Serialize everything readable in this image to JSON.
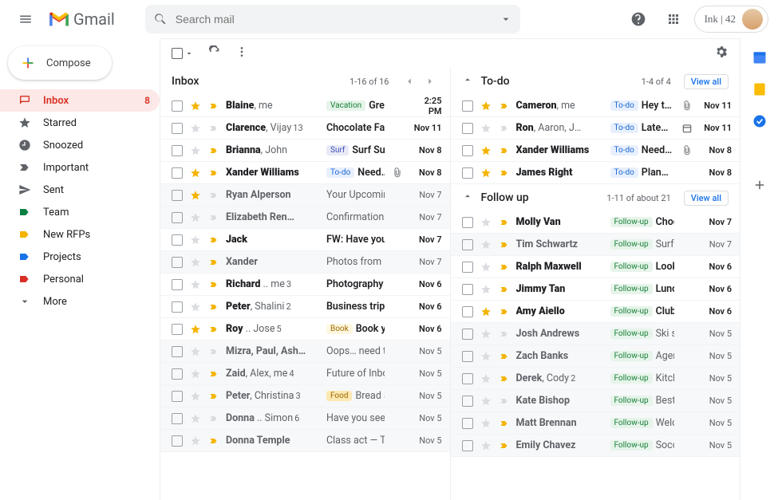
{
  "header": {
    "app_name": "Gmail",
    "search_placeholder": "Search mail",
    "profile_label": "Ink | 42"
  },
  "compose_label": "Compose",
  "nav": [
    {
      "icon": "inbox",
      "label": "Inbox",
      "count": "8",
      "active": true
    },
    {
      "icon": "star",
      "label": "Starred"
    },
    {
      "icon": "clock",
      "label": "Snoozed"
    },
    {
      "icon": "important",
      "label": "Important"
    },
    {
      "icon": "send",
      "label": "Sent"
    },
    {
      "icon": "tag-green",
      "label": "Team"
    },
    {
      "icon": "tag-yellow",
      "label": "New RFPs"
    },
    {
      "icon": "tag-blue",
      "label": "Projects"
    },
    {
      "icon": "tag-red",
      "label": "Personal"
    },
    {
      "icon": "more",
      "label": "More"
    }
  ],
  "inbox": {
    "title": "Inbox",
    "range": "1-16 of 16",
    "rows": [
      {
        "unread": true,
        "star": true,
        "marker": true,
        "from": "Blaine",
        "from2": ", me",
        "tag": "Vacation",
        "tag_cls": "vacation",
        "subject": "Greece…",
        "date": "2:25 PM"
      },
      {
        "unread": true,
        "star": false,
        "marker": false,
        "from": "Clarence",
        "from2": ", Vijay",
        "tnum": "13",
        "subject": "Chocolate Factor…",
        "date": "Nov 11"
      },
      {
        "unread": true,
        "star": false,
        "marker": true,
        "from": "Brianna",
        "from2": ", John",
        "tag": "Surf",
        "tag_cls": "surf",
        "subject": "Surf Sunda…",
        "date": "Nov 8"
      },
      {
        "unread": true,
        "star": true,
        "marker": true,
        "from": "Xander Williams",
        "tag": "To-do",
        "tag_cls": "todo",
        "subject": "Need…",
        "attach": true,
        "date": "Nov 8"
      },
      {
        "unread": false,
        "star": true,
        "marker": false,
        "from": "Ryan Alperson",
        "subject": "Your Upcoming R…",
        "date": "Nov 7"
      },
      {
        "unread": false,
        "star": false,
        "marker": false,
        "from": "Elizabeth Ren…",
        "subject": "Confirmation for…",
        "date": "Nov 7"
      },
      {
        "unread": true,
        "star": false,
        "marker": true,
        "from": "Jack",
        "subject": "FW: Have you ev…",
        "date": "Nov 7"
      },
      {
        "unread": false,
        "star": false,
        "marker": true,
        "from": "Xander",
        "subject": "Photos from my r…",
        "date": "Nov 7"
      },
      {
        "unread": true,
        "star": false,
        "marker": true,
        "from": "Richard",
        "from2": " .. me",
        "tnum": "3",
        "subject": "Photography clas…",
        "date": "Nov 6"
      },
      {
        "unread": true,
        "star": false,
        "marker": true,
        "from": "Peter",
        "from2": ", Shalini",
        "tnum": "2",
        "subject": "Business trip — H…",
        "date": "Nov 6"
      },
      {
        "unread": true,
        "star": true,
        "marker": true,
        "from": "Roy",
        "from2": " .. Jose",
        "tnum": "5",
        "tag": "Book",
        "tag_cls": "book",
        "subject": "Book you r…",
        "date": "Nov 6"
      },
      {
        "unread": false,
        "star": false,
        "marker": false,
        "from": "Mizra, Paul, Ash…",
        "subject": "Oops… need to re…",
        "date": "Nov 5"
      },
      {
        "unread": false,
        "star": false,
        "marker": true,
        "from": "Zaid",
        "from2": ", Alex, me",
        "tnum": "4",
        "subject": "Future of Inbox —…",
        "date": "Nov 5"
      },
      {
        "unread": false,
        "star": false,
        "marker": true,
        "from": "Peter",
        "from2": ", Christina",
        "tnum": "3",
        "tag": "Food",
        "tag_cls": "food",
        "subject": "Bread and…",
        "date": "Nov 5"
      },
      {
        "unread": false,
        "star": false,
        "marker": false,
        "from": "Donna",
        "from2": " .. Simon",
        "tnum": "6",
        "subject": "Have you seen th…",
        "date": "Nov 5"
      },
      {
        "unread": false,
        "star": false,
        "marker": true,
        "from": "Donna Temple",
        "subject": "Class act — Tom…",
        "date": "Nov 5"
      }
    ]
  },
  "sections": [
    {
      "title": "To-do",
      "range": "1-4 of 4",
      "viewall": "View all",
      "rows": [
        {
          "unread": true,
          "star": true,
          "marker": true,
          "from": "Cameron",
          "from2": ", me",
          "tag": "To-do",
          "tag_cls": "todo",
          "subject": "Hey t…",
          "attach": true,
          "date": "Nov 11"
        },
        {
          "unread": true,
          "star": false,
          "marker": false,
          "from": "Ron",
          "from2": ", Aaron, J…",
          "tag": "To-do",
          "tag_cls": "todo",
          "subject": "Late…",
          "cal": true,
          "date": "Nov 11"
        },
        {
          "unread": true,
          "star": true,
          "marker": true,
          "from": "Xander Williams",
          "tag": "To-do",
          "tag_cls": "todo",
          "subject": "Need…",
          "attach": true,
          "date": "Nov 8"
        },
        {
          "unread": true,
          "star": true,
          "marker": true,
          "from": "James Right",
          "tag": "To-do",
          "tag_cls": "todo",
          "subject": "Plan…",
          "date": "Nov 8"
        }
      ]
    },
    {
      "title": "Follow up",
      "range": "1-11 of about 21",
      "viewall": "View all",
      "rows": [
        {
          "unread": true,
          "star": false,
          "marker": true,
          "from": "Molly Van",
          "tag": "Follow-up",
          "tag_cls": "follow",
          "subject": "Choco…",
          "date": "Nov 7"
        },
        {
          "unread": false,
          "star": false,
          "marker": true,
          "from": "Tim Schwartz",
          "tag": "Follow-up",
          "tag_cls": "follow",
          "subject": "Surf S…",
          "date": "Nov 7"
        },
        {
          "unread": true,
          "star": false,
          "marker": true,
          "from": "Ralph Maxwell",
          "tag": "Follow-up",
          "tag_cls": "follow",
          "subject": "Looki…",
          "date": "Nov 6"
        },
        {
          "unread": true,
          "star": false,
          "marker": true,
          "from": "Jimmy Tan",
          "tag": "Follow-up",
          "tag_cls": "follow",
          "subject": "Lunch…",
          "date": "Nov 6"
        },
        {
          "unread": true,
          "star": true,
          "marker": true,
          "from": "Amy Aiello",
          "tag": "Follow-up",
          "tag_cls": "follow",
          "subject": "Club…",
          "date": "Nov 6"
        },
        {
          "unread": false,
          "star": false,
          "marker": false,
          "from": "Josh Andrews",
          "tag": "Follow-up",
          "tag_cls": "follow",
          "subject": "Ski se…",
          "date": "Nov 5"
        },
        {
          "unread": false,
          "star": false,
          "marker": true,
          "from": "Zach Banks",
          "tag": "Follow-up",
          "tag_cls": "follow",
          "subject": "Agend…",
          "date": "Nov 5"
        },
        {
          "unread": false,
          "star": false,
          "marker": true,
          "from": "Derek",
          "from2": ", Cody",
          "tnum": "2",
          "tag": "Follow-up",
          "tag_cls": "follow",
          "subject": "Kitche…",
          "date": "Nov 5"
        },
        {
          "unread": false,
          "star": false,
          "marker": false,
          "from": "Kate Bishop",
          "tag": "Follow-up",
          "tag_cls": "follow",
          "subject": "Best…",
          "date": "Nov 5"
        },
        {
          "unread": false,
          "star": false,
          "marker": true,
          "from": "Matt Brennan",
          "tag": "Follow-up",
          "tag_cls": "follow",
          "subject": "Welco…",
          "date": "Nov 5"
        },
        {
          "unread": false,
          "star": false,
          "marker": true,
          "from": "Emily Chavez",
          "tag": "Follow-up",
          "tag_cls": "follow",
          "subject": "Socce…",
          "date": "Nov 5"
        }
      ]
    }
  ]
}
